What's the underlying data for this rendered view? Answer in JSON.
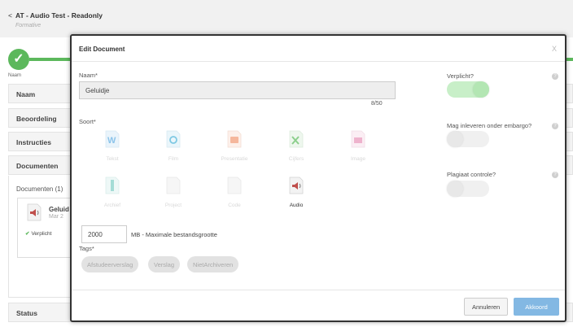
{
  "background": {
    "title": "AT - Audio Test - Readonly",
    "subtitle": "Formative",
    "naam_small": "Naam",
    "sections": [
      "Naam",
      "Beoordeling",
      "Instructies",
      "Documenten",
      "Status"
    ],
    "documents_title": "Documenten (1)",
    "doc_name": "Geluid",
    "doc_date": "Mar 2",
    "doc_required": "Verplicht",
    "accent": "#5cb85c"
  },
  "modal": {
    "title": "Edit Document",
    "close": "X",
    "naam_label": "Naam*",
    "naam_value": "Geluidje",
    "counter": "8/50",
    "soort_label": "Soort*",
    "soort_items": [
      {
        "label": "Tekst",
        "icon": "word-icon"
      },
      {
        "label": "Film",
        "icon": "film-icon"
      },
      {
        "label": "Presentatie",
        "icon": "presentation-icon"
      },
      {
        "label": "Cijfers",
        "icon": "spreadsheet-icon"
      },
      {
        "label": "Image",
        "icon": "image-icon"
      },
      {
        "label": "Archief",
        "icon": "archive-icon"
      },
      {
        "label": "Project",
        "icon": "project-icon"
      },
      {
        "label": "Code",
        "icon": "code-icon"
      },
      {
        "label": "Audio",
        "icon": "audio-icon",
        "active": true
      }
    ],
    "max_size_value": "2000",
    "max_size_label": "MB - Maximale bestandsgrootte",
    "tags_label": "Tags*",
    "tags": [
      "Afstudeerverslag",
      "Verslag",
      "NietArchiveren"
    ],
    "verplicht_label": "Verplicht?",
    "verplicht_on": true,
    "embargo_label": "Mag inleveren onder embargo?",
    "embargo_on": false,
    "plagiaat_label": "Plagiaat controle?",
    "plagiaat_on": false,
    "help_glyph": "?",
    "cancel_label": "Annuleren",
    "ok_label": "Akkoord",
    "colors": {
      "primary": "#83b8e3",
      "toggle_on": "#c8efc8"
    }
  }
}
